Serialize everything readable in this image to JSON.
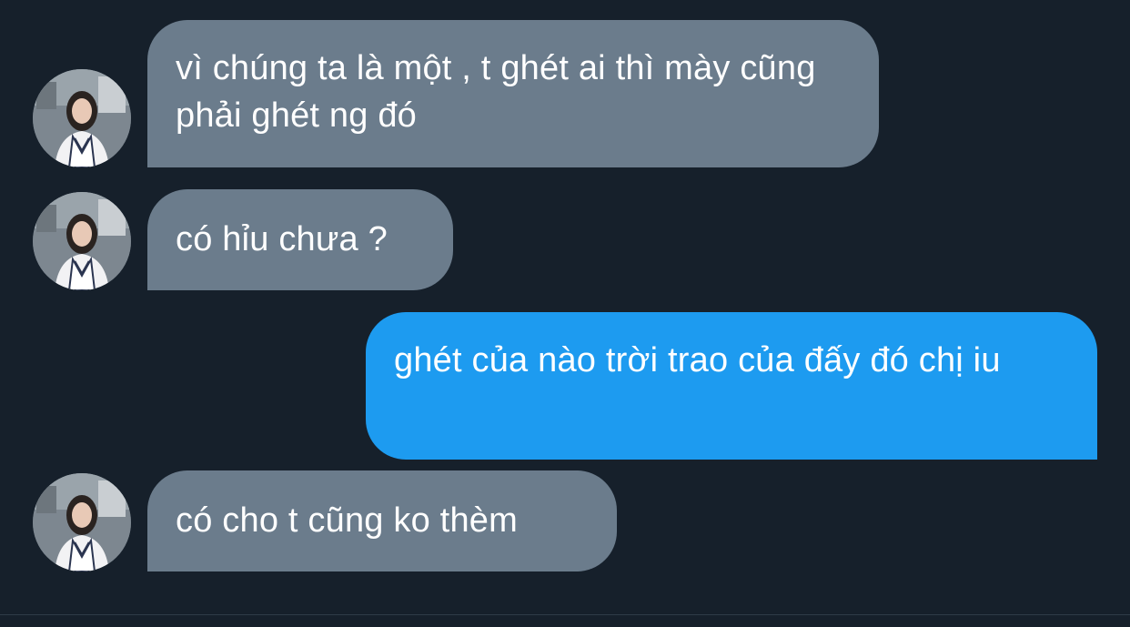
{
  "colors": {
    "background": "#16202b",
    "received_bubble": "#6b7c8c",
    "sent_bubble": "#1d9bf0",
    "text": "#ffffff"
  },
  "messages": [
    {
      "direction": "received",
      "avatar_icon": "contact-avatar",
      "text": "vì chúng ta là một , t ghét ai thì mày cũng phải ghét ng đó"
    },
    {
      "direction": "received",
      "avatar_icon": "contact-avatar",
      "text": "có hỉu chưa ?"
    },
    {
      "direction": "sent",
      "text": "ghét của nào trời trao của đấy đó chị iu"
    },
    {
      "direction": "received",
      "avatar_icon": "contact-avatar",
      "text": "có cho t cũng ko thèm"
    }
  ]
}
